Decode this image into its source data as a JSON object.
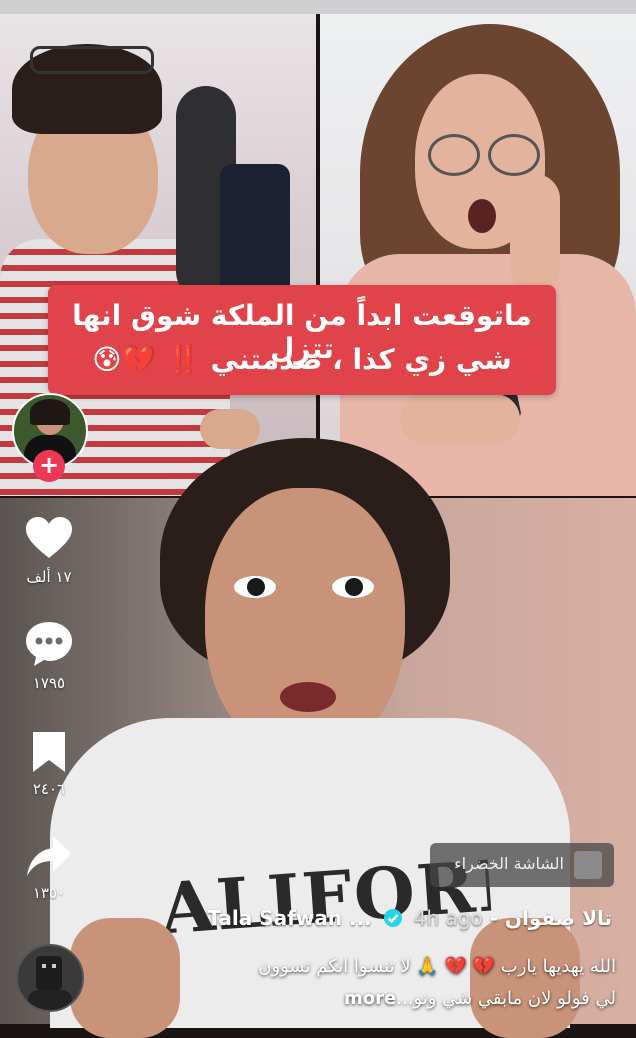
{
  "caption": {
    "line1": "ماتوقعت ابداً من الملكة شوق انها تتزل",
    "line2": "شي زي كذا ، صدمتني ‼️ 💔😰"
  },
  "rail": {
    "likes": "١٧ ألف",
    "comments": "١٧٩٥",
    "saves": "٢٤٠٦",
    "shares": "١٣٥٠"
  },
  "green_screen_label": "الشاشة الخضراء",
  "post": {
    "author": "تالا صفوان - Tala Safwan ...",
    "time": "4h ago",
    "desc_line1": "الله يهديها يارب 💔 💔 🙏 لا تنسوا انكم تسوون",
    "desc_line2": "لي فولو لان مابقي شي ونو...",
    "more": "more"
  },
  "icons": {
    "like": "heart-icon",
    "comment": "chat-bubble-icon",
    "save": "bookmark-icon",
    "share": "share-arrow-icon",
    "follow": "plus-icon",
    "verified": "verified-badge-icon"
  }
}
